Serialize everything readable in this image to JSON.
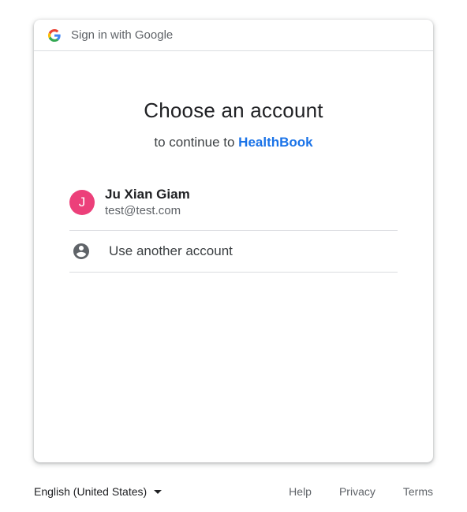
{
  "header": {
    "label": "Sign in with Google"
  },
  "main": {
    "title": "Choose an account",
    "subtitle_prefix": "to continue to ",
    "app_name": "HealthBook"
  },
  "accounts": [
    {
      "initial": "J",
      "name": "Ju Xian Giam",
      "email": "test@test.com",
      "avatar_color": "#ec407a"
    }
  ],
  "other_account": {
    "label": "Use another account",
    "icon": "account-circle-icon"
  },
  "footer": {
    "language": "English (United States)",
    "links": [
      "Help",
      "Privacy",
      "Terms"
    ]
  },
  "colors": {
    "accent": "#1a73e8",
    "divider": "#dadce0"
  }
}
